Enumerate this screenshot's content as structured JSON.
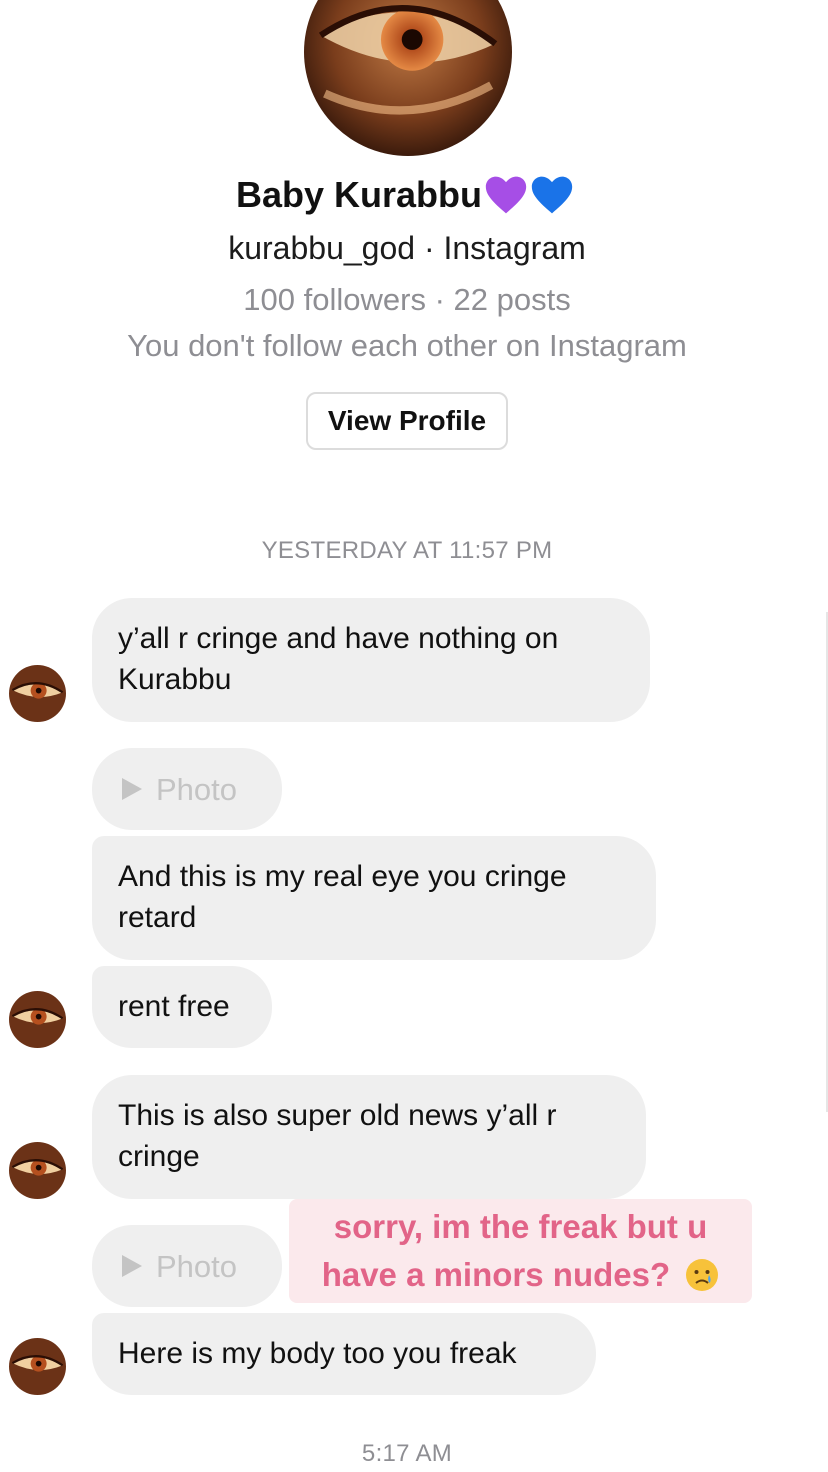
{
  "profile": {
    "name": "Baby Kurabbu",
    "handle_line": "kurabbu_god · Instagram",
    "stats_line": "100 followers · 22 posts",
    "follow_line": "You don't follow each other on Instagram",
    "view_profile_label": "View Profile",
    "name_emojis": [
      "purple-heart-icon",
      "blue-heart-icon"
    ]
  },
  "timestamps": {
    "first": "YESTERDAY AT 11:57 PM",
    "last": "5:17 AM"
  },
  "messages": [
    {
      "kind": "text",
      "line1": "y’all r cringe and have nothing on",
      "line2": "Kurabbu"
    },
    {
      "kind": "photo",
      "label": "Photo"
    },
    {
      "kind": "text",
      "line1": "And this is my real eye you cringe",
      "line2": "retard"
    },
    {
      "kind": "text",
      "line1": "rent free"
    },
    {
      "kind": "text",
      "line1": "This is also super old news y’all r",
      "line2": "cringe"
    },
    {
      "kind": "photo",
      "label": "Photo"
    },
    {
      "kind": "text",
      "line1": "Here is my body too you freak"
    }
  ],
  "overlay_caption": {
    "line1": "sorry, im the freak but u",
    "line2": "have a minors nudes?",
    "emoji": "crying-face-icon"
  },
  "colors": {
    "bubble_bg": "#efefef",
    "muted_text": "#8e8e93",
    "caption_text": "#e26488",
    "caption_bg": "#fbe9ec"
  }
}
